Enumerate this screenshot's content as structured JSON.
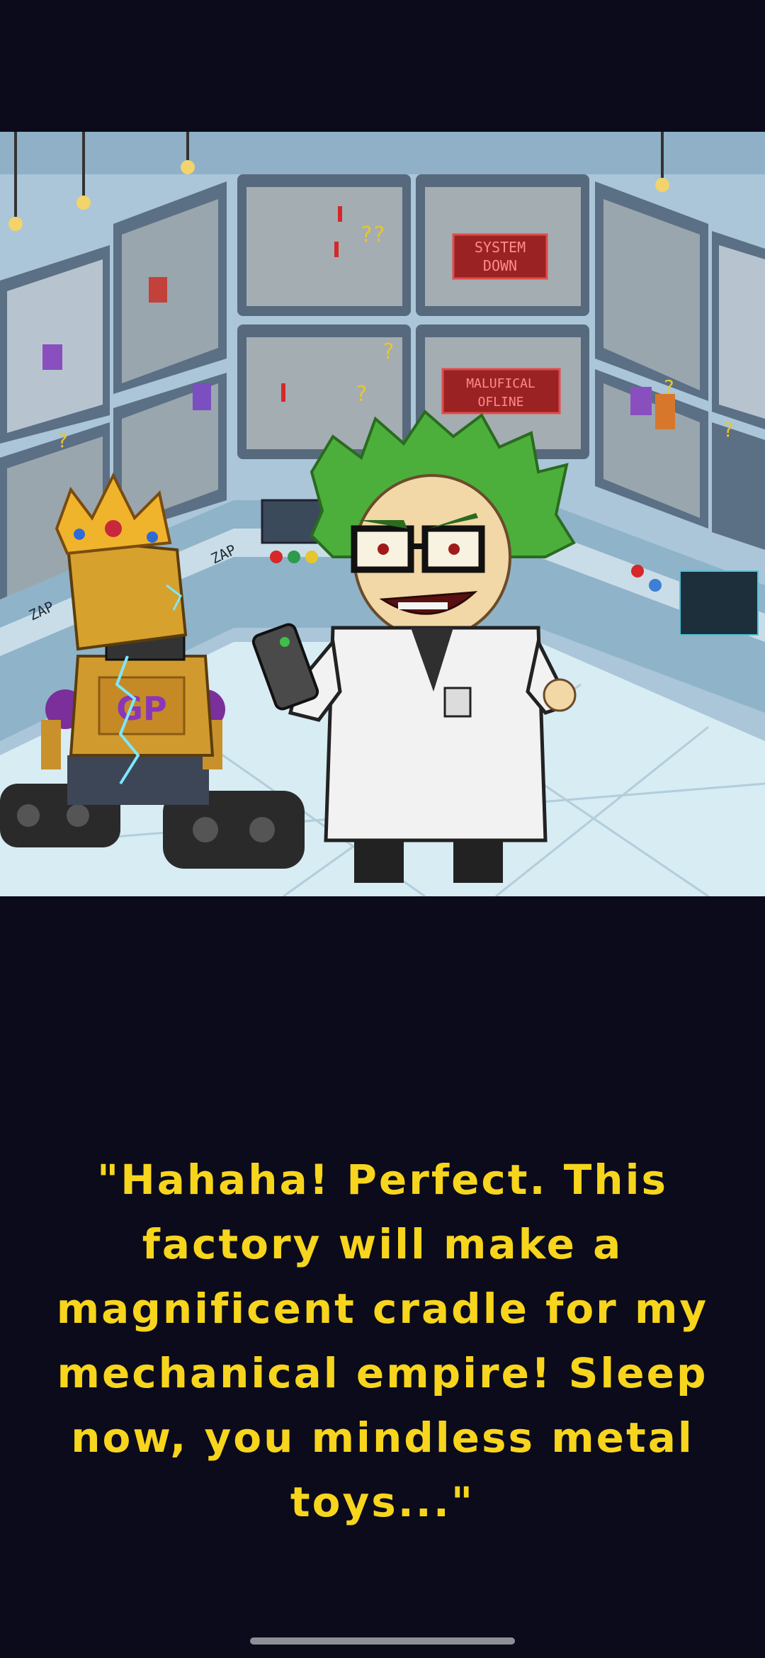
{
  "scene": {
    "screen_signs": [
      "SYSTEM",
      "DOWN",
      "MALUFICAL",
      "OFLINE"
    ],
    "console_labels": [
      "ZAP",
      "ZAP"
    ],
    "robot_chest_logo": "GP",
    "question_marks": [
      "??",
      "?",
      "?",
      "?",
      "?",
      "?"
    ]
  },
  "dialogue": {
    "text": "\"Hahaha! Perfect. This factory will make a magnificent cradle for my mechanical empire! Sleep now, you mindless metal toys...\""
  },
  "colors": {
    "background": "#0b0b1c",
    "dialogue_text": "#f7d51d",
    "home_indicator": "#8e8e96"
  }
}
